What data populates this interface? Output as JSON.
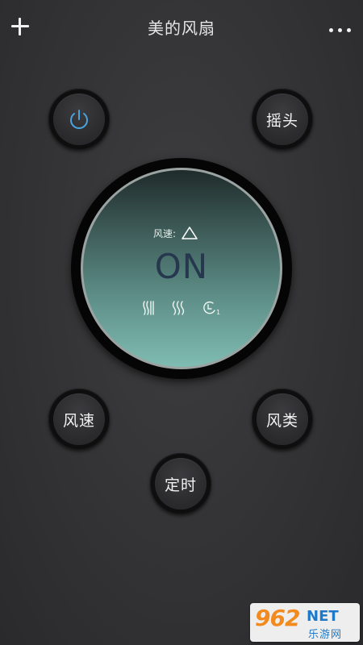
{
  "header": {
    "title": "美的风扇",
    "add_icon": "plus-icon",
    "more_icon": "more-dots-icon"
  },
  "controls": {
    "power": {
      "icon": "power-icon",
      "color": "#4aa3df"
    },
    "swing_label": "摇头",
    "speed_label": "风速",
    "mode_label": "风类",
    "timer_label": "定时"
  },
  "dial": {
    "speed_label": "风速:",
    "speed_icon": "triangle-outline-icon",
    "status": "ON",
    "mode_icons": [
      "vertical-wind-icon",
      "wavy-wind-icon",
      "timer-clock-icon"
    ],
    "timer_value": "1"
  },
  "watermark": {
    "number": "962",
    "net": "NET",
    "name": "乐游网"
  }
}
